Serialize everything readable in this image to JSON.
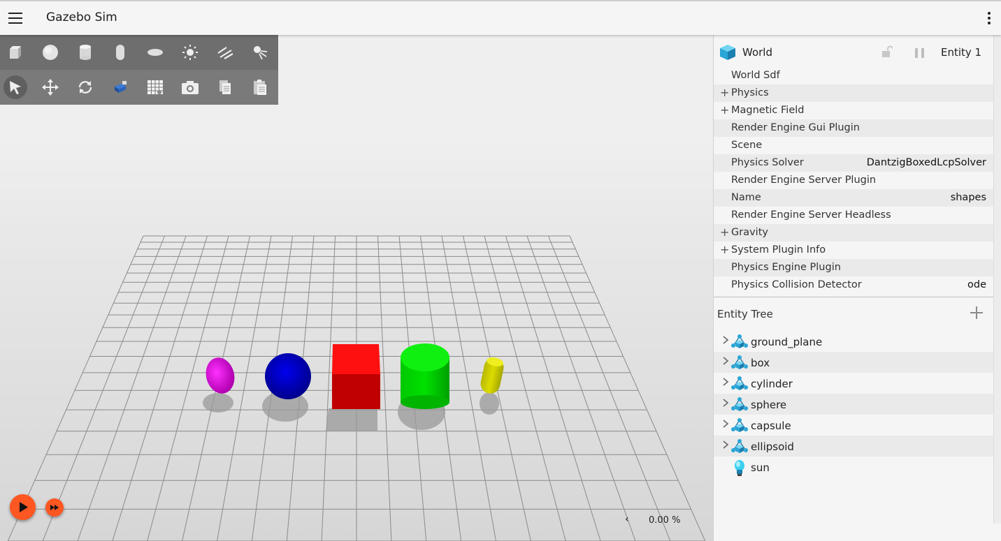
{
  "app": {
    "title": "Gazebo Sim"
  },
  "colors": {
    "accent": "#ff5722",
    "box": "#ff0000",
    "sphere": "#0000dd",
    "cylinder": "#00dd00",
    "capsule": "#cccc00",
    "ellipsoid": "#ee00ee",
    "entity_icon": "#2aa6d6"
  },
  "toolbar": {
    "shapes": [
      "box-icon",
      "sphere-icon",
      "cylinder-icon",
      "capsule-icon",
      "ellipsoid-icon",
      "sun-light-icon",
      "directional-light-icon",
      "spot-light-icon"
    ],
    "tools": [
      "select-arrow-icon",
      "translate-icon",
      "rotate-icon",
      "transform-control-icon",
      "grid-snap-icon",
      "screenshot-camera-icon",
      "copy-icon",
      "paste-icon"
    ]
  },
  "component_inspector": {
    "header": {
      "title": "World",
      "entity": "Entity 1"
    },
    "rows": [
      {
        "label": "World Sdf",
        "value": "",
        "expandable": false
      },
      {
        "label": "Physics",
        "value": "",
        "expandable": true
      },
      {
        "label": "Magnetic Field",
        "value": "",
        "expandable": true
      },
      {
        "label": "Render Engine Gui Plugin",
        "value": "",
        "expandable": false
      },
      {
        "label": "Scene",
        "value": "",
        "expandable": false
      },
      {
        "label": "Physics Solver",
        "value": "DantzigBoxedLcpSolver",
        "expandable": false
      },
      {
        "label": "Render Engine Server Plugin",
        "value": "",
        "expandable": false
      },
      {
        "label": "Name",
        "value": "shapes",
        "expandable": false
      },
      {
        "label": "Render Engine Server Headless",
        "value": "",
        "expandable": false
      },
      {
        "label": "Gravity",
        "value": "",
        "expandable": true
      },
      {
        "label": "System Plugin Info",
        "value": "",
        "expandable": true
      },
      {
        "label": "Physics Engine Plugin",
        "value": "",
        "expandable": false
      },
      {
        "label": "Physics Collision Detector",
        "value": "ode",
        "expandable": false
      }
    ]
  },
  "entity_tree": {
    "title": "Entity Tree",
    "items": [
      {
        "name": "ground_plane",
        "icon": "model-icon",
        "expandable": true
      },
      {
        "name": "box",
        "icon": "model-icon",
        "expandable": true
      },
      {
        "name": "cylinder",
        "icon": "model-icon",
        "expandable": true
      },
      {
        "name": "sphere",
        "icon": "model-icon",
        "expandable": true
      },
      {
        "name": "capsule",
        "icon": "model-icon",
        "expandable": true
      },
      {
        "name": "ellipsoid",
        "icon": "model-icon",
        "expandable": true
      },
      {
        "name": "sun",
        "icon": "light-bulb-icon",
        "expandable": false
      }
    ]
  },
  "playback": {
    "real_time_factor": "0.00 %",
    "collapse_glyph": "‹"
  }
}
